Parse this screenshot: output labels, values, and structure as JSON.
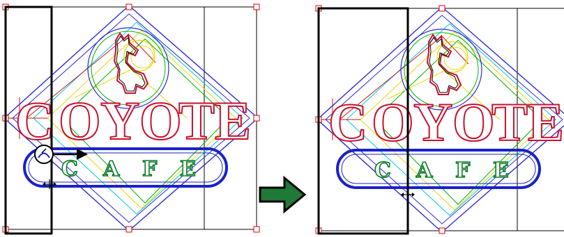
{
  "title_word": [
    "C",
    "O",
    "Y",
    "O",
    "T",
    "E"
  ],
  "subtitle_word": [
    "C",
    "A",
    "F",
    "E"
  ],
  "colors": {
    "background": "#ffffff",
    "frame_line": "#000000",
    "selection_box": "#000000",
    "handle": "#e00000",
    "diamond": "#2a2ad8",
    "inner_yellow": "#e6d800",
    "inner_cyan": "#00c8e0",
    "inner_green": "#00b000",
    "inner_red": "#d01010",
    "letters_red": "#c8102e",
    "oval_blue": "#1a22c8",
    "cafe_green": "#0a7a2a",
    "arrow_fill": "#1e7a36",
    "arrow_outline": "#000000"
  },
  "icons": {
    "drag_cursor": "zoom-drag-cursor-icon",
    "resize_cursor": "horizontal-resize-cursor-icon",
    "direction_arrow": "right-arrow-icon",
    "transition_arrow": "green-right-arrow-icon",
    "handle": "selection-handle-icon"
  },
  "panels": {
    "before": {
      "label": "before-resize"
    },
    "after": {
      "label": "after-resize"
    }
  }
}
